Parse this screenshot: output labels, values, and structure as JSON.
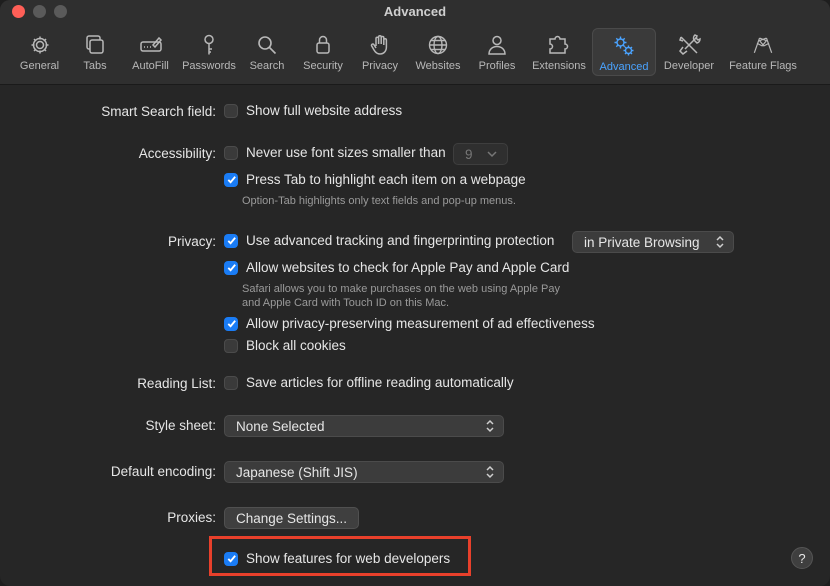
{
  "window": {
    "title": "Advanced"
  },
  "toolbar": {
    "items": [
      {
        "label": "General",
        "icon": "gear-icon"
      },
      {
        "label": "Tabs",
        "icon": "tabs-icon"
      },
      {
        "label": "AutoFill",
        "icon": "pencil-field-icon"
      },
      {
        "label": "Passwords",
        "icon": "key-icon"
      },
      {
        "label": "Search",
        "icon": "magnifier-icon"
      },
      {
        "label": "Security",
        "icon": "lock-icon"
      },
      {
        "label": "Privacy",
        "icon": "hand-icon"
      },
      {
        "label": "Websites",
        "icon": "globe-icon"
      },
      {
        "label": "Profiles",
        "icon": "person-icon"
      },
      {
        "label": "Extensions",
        "icon": "puzzle-icon"
      },
      {
        "label": "Advanced",
        "icon": "gears-icon",
        "active": true
      },
      {
        "label": "Developer",
        "icon": "tools-icon"
      },
      {
        "label": "Feature Flags",
        "icon": "flags-icon"
      }
    ],
    "active_color": "#4aa3ff"
  },
  "settings": {
    "smart_search": {
      "label": "Smart Search field:",
      "option": "Show full website address",
      "checked": false
    },
    "accessibility": {
      "label": "Accessibility:",
      "min_font": {
        "option": "Never use font sizes smaller than",
        "checked": false,
        "size_value": "9"
      },
      "tab_highlight": {
        "option": "Press Tab to highlight each item on a webpage",
        "checked": true,
        "note": "Option-Tab highlights only text fields and pop-up menus."
      }
    },
    "privacy": {
      "label": "Privacy:",
      "tracking": {
        "option": "Use advanced tracking and fingerprinting protection",
        "checked": true,
        "scope": "in Private Browsing"
      },
      "apple_pay": {
        "option": "Allow websites to check for Apple Pay and Apple Card",
        "checked": true,
        "note_line1": "Safari allows you to make purchases on the web using Apple Pay",
        "note_line2": "and Apple Card with Touch ID on this Mac."
      },
      "ad_measure": {
        "option": "Allow privacy-preserving measurement of ad effectiveness",
        "checked": true
      },
      "block_cookies": {
        "option": "Block all cookies",
        "checked": false
      }
    },
    "reading_list": {
      "label": "Reading List:",
      "option": "Save articles for offline reading automatically",
      "checked": false
    },
    "style_sheet": {
      "label": "Style sheet:",
      "value": "None Selected"
    },
    "encoding": {
      "label": "Default encoding:",
      "value": "Japanese (Shift JIS)"
    },
    "proxies": {
      "label": "Proxies:",
      "button": "Change Settings..."
    },
    "developer": {
      "option": "Show features for web developers",
      "checked": true
    }
  },
  "help": {
    "label": "?"
  },
  "colors": {
    "checkbox_on": "#1a7cf5",
    "highlight_box": "#e8402b"
  }
}
